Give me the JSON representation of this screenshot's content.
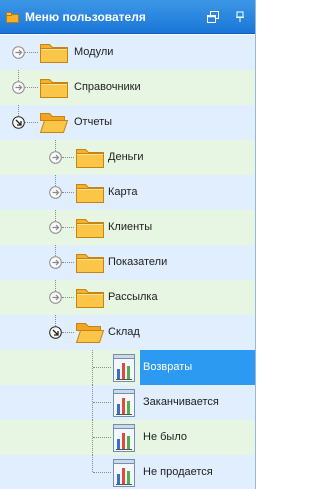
{
  "panel": {
    "title": "Меню пользователя"
  },
  "tree": [
    {
      "label": "Модули",
      "icon": "folder-closed-icon",
      "level": 0,
      "state": "collapsed"
    },
    {
      "label": "Справочники",
      "icon": "folder-closed-icon",
      "level": 0,
      "state": "collapsed"
    },
    {
      "label": "Отчеты",
      "icon": "folder-open-icon",
      "level": 0,
      "state": "expanded"
    },
    {
      "label": "Деньги",
      "icon": "folder-closed-icon",
      "level": 1,
      "state": "collapsed"
    },
    {
      "label": "Карта",
      "icon": "folder-closed-icon",
      "level": 1,
      "state": "collapsed"
    },
    {
      "label": "Клиенты",
      "icon": "folder-closed-icon",
      "level": 1,
      "state": "collapsed"
    },
    {
      "label": "Показатели",
      "icon": "folder-closed-icon",
      "level": 1,
      "state": "collapsed"
    },
    {
      "label": "Рассылка",
      "icon": "folder-closed-icon",
      "level": 1,
      "state": "collapsed"
    },
    {
      "label": "Склад",
      "icon": "folder-open-icon",
      "level": 1,
      "state": "expanded"
    },
    {
      "label": "Возвраты",
      "icon": "report-icon",
      "level": 2,
      "selected": true
    },
    {
      "label": "Заканчивается",
      "icon": "report-icon",
      "level": 2
    },
    {
      "label": "Не было",
      "icon": "report-icon",
      "level": 2
    },
    {
      "label": "Не продается",
      "icon": "report-icon",
      "level": 2
    }
  ]
}
